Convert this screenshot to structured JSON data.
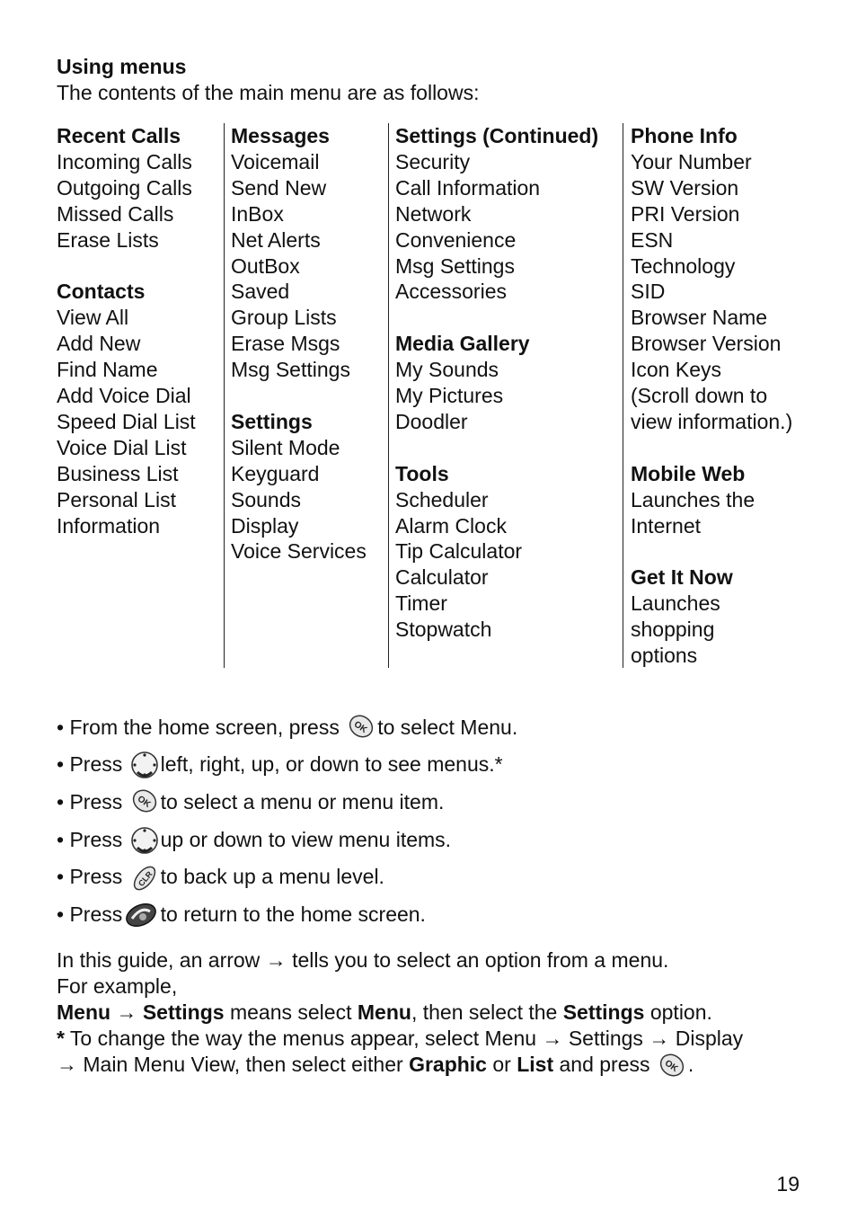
{
  "heading": "Using menus",
  "intro": "The contents of the main menu are as follows:",
  "columns": {
    "c1": {
      "groups": [
        {
          "title": "Recent Calls",
          "items": [
            "Incoming Calls",
            "Outgoing Calls",
            "Missed Calls",
            "Erase Lists"
          ]
        },
        {
          "title": "Contacts",
          "items": [
            "View All",
            "Add New",
            "Find Name",
            "Add Voice Dial",
            "Speed Dial List",
            "Voice Dial List",
            "Business List",
            "Personal List",
            "Information"
          ]
        }
      ]
    },
    "c2": {
      "groups": [
        {
          "title": "Messages",
          "items": [
            "Voicemail",
            "Send New",
            "InBox",
            "Net Alerts",
            "OutBox",
            "Saved",
            "Group Lists",
            "Erase Msgs",
            "Msg Settings"
          ]
        },
        {
          "title": "Settings",
          "items": [
            "Silent Mode",
            "Keyguard",
            "Sounds",
            "Display",
            "Voice Services"
          ]
        }
      ]
    },
    "c3": {
      "groups": [
        {
          "title": "Settings (Continued)",
          "items": [
            "Security",
            "Call Information",
            "Network",
            "Convenience",
            "Msg Settings",
            "Accessories"
          ]
        },
        {
          "title": "Media Gallery",
          "items": [
            "My Sounds",
            "My Pictures",
            "Doodler"
          ]
        },
        {
          "title": "Tools",
          "items": [
            "Scheduler",
            "Alarm Clock",
            "Tip Calculator",
            "Calculator",
            "Timer",
            "Stopwatch"
          ]
        }
      ]
    },
    "c4": {
      "groups": [
        {
          "title": "Phone Info",
          "items": [
            "Your Number",
            "SW Version",
            "PRI Version",
            "ESN",
            "Technology",
            "SID",
            "Browser Name",
            "Browser Version",
            "Icon Keys",
            "(Scroll down to",
            "view information.)"
          ]
        },
        {
          "title": "Mobile Web",
          "items": [
            "Launches the",
            "Internet"
          ]
        },
        {
          "title": "Get It Now",
          "items": [
            "Launches",
            "shopping",
            "options"
          ]
        }
      ]
    }
  },
  "bullets": [
    {
      "before": "• From the home screen, press ",
      "icon": "ok-key-icon",
      "after": "to select Menu."
    },
    {
      "before": "• Press ",
      "icon": "nav-key-icon",
      "after": "left, right, up, or down to see menus.*"
    },
    {
      "before": "• Press ",
      "icon": "ok-key-icon",
      "after": "to select a menu or menu item."
    },
    {
      "before": "• Press ",
      "icon": "nav-key-icon",
      "after": "up or down to view menu items."
    },
    {
      "before": "• Press ",
      "icon": "clr-key-icon",
      "after": "to back up a menu level."
    },
    {
      "before": "• Press",
      "icon": "end-key-icon",
      "after": " to return to the home screen."
    }
  ],
  "guide": {
    "line1_a": "In this guide, an arrow ",
    "arrow": "→",
    "line1_b": " tells you to select an option from a menu.",
    "line2": "For example,",
    "line3_menu": "Menu",
    "line3_settings": "Settings",
    "line3_mid": " means select ",
    "line3_menu2": "Menu",
    "line3_mid2": ", then select the ",
    "line3_settings2": "Settings",
    "line3_end": " option.",
    "note_star": "*",
    "note_a": " To change the way the menus appear, select Menu ",
    "note_b": " Settings ",
    "note_c": " Display",
    "note_d": " Main Menu View, then select either ",
    "note_graphic": "Graphic",
    "note_or": " or ",
    "note_list": "List",
    "note_end": " and press ",
    "note_period": "."
  },
  "page_number": "19"
}
